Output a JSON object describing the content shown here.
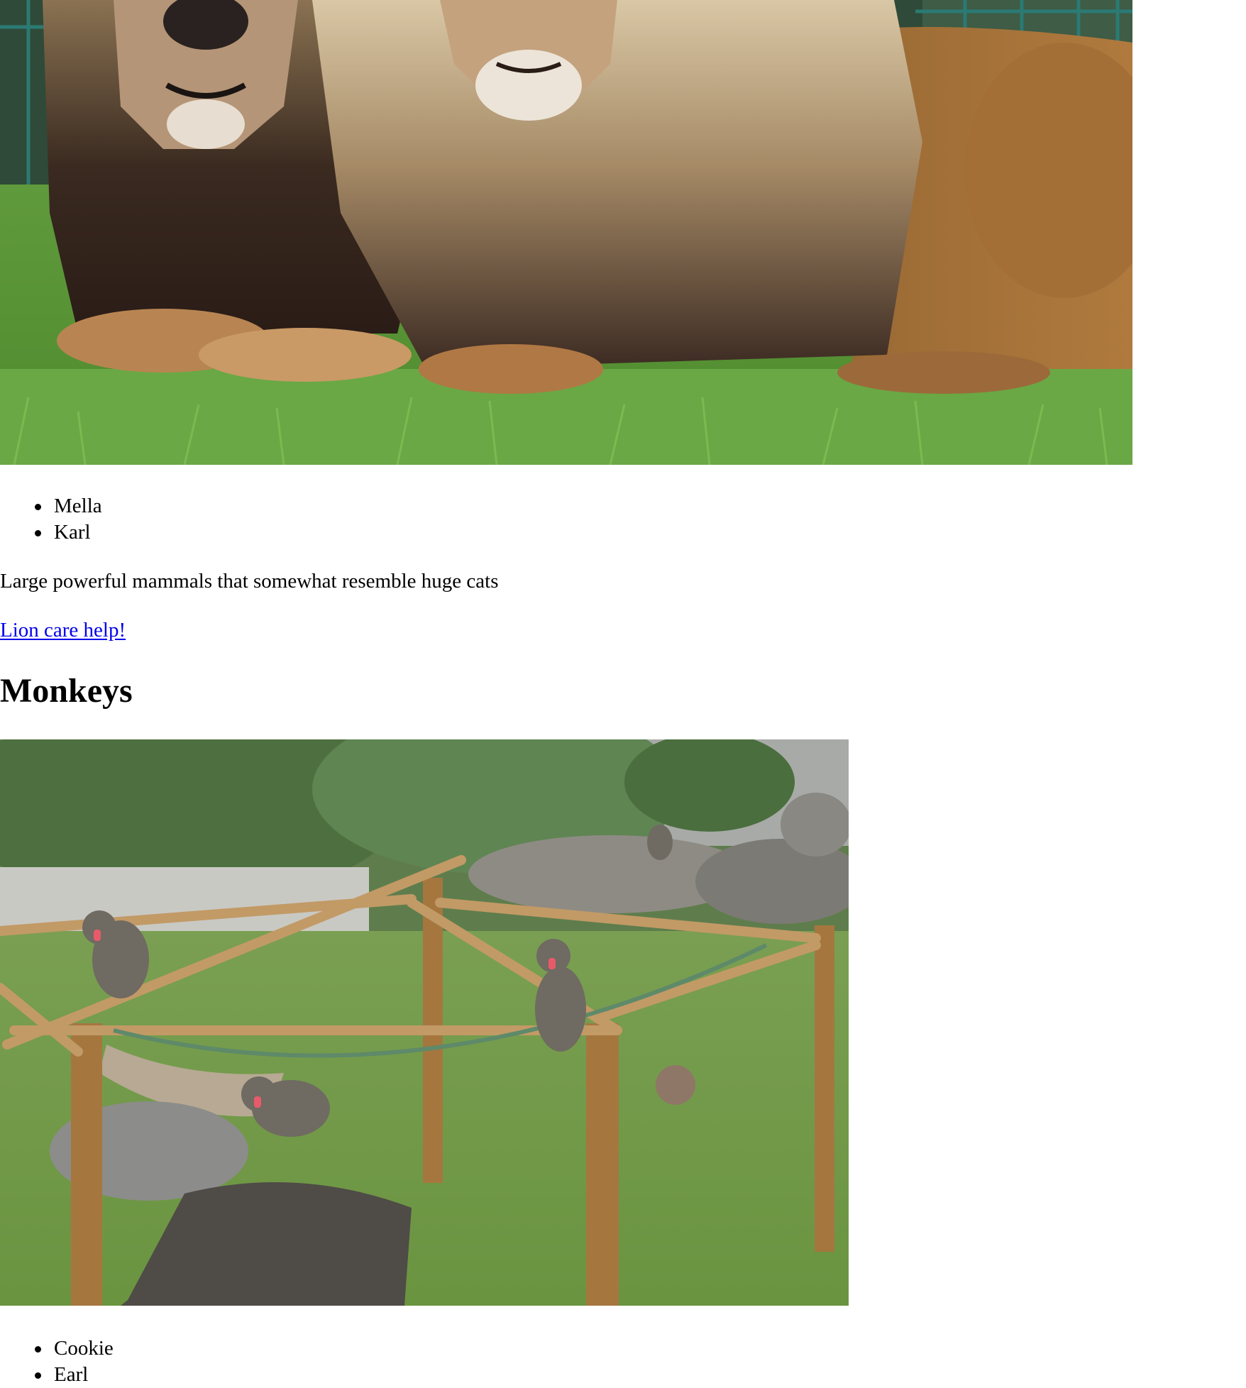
{
  "lions": {
    "image_alt": "Two male lions lying in grass",
    "names": [
      "Mella",
      "Karl"
    ],
    "description": "Large powerful mammals that somewhat resemble huge cats",
    "link_text": "Lion care help!"
  },
  "monkeys": {
    "heading": "Monkeys",
    "image_alt": "Mandrills in a zoo enclosure with wooden climbing frame",
    "names": [
      "Cookie",
      "Earl"
    ]
  },
  "colors": {
    "link": "#0000ee",
    "text": "#000000",
    "background": "#ffffff"
  }
}
